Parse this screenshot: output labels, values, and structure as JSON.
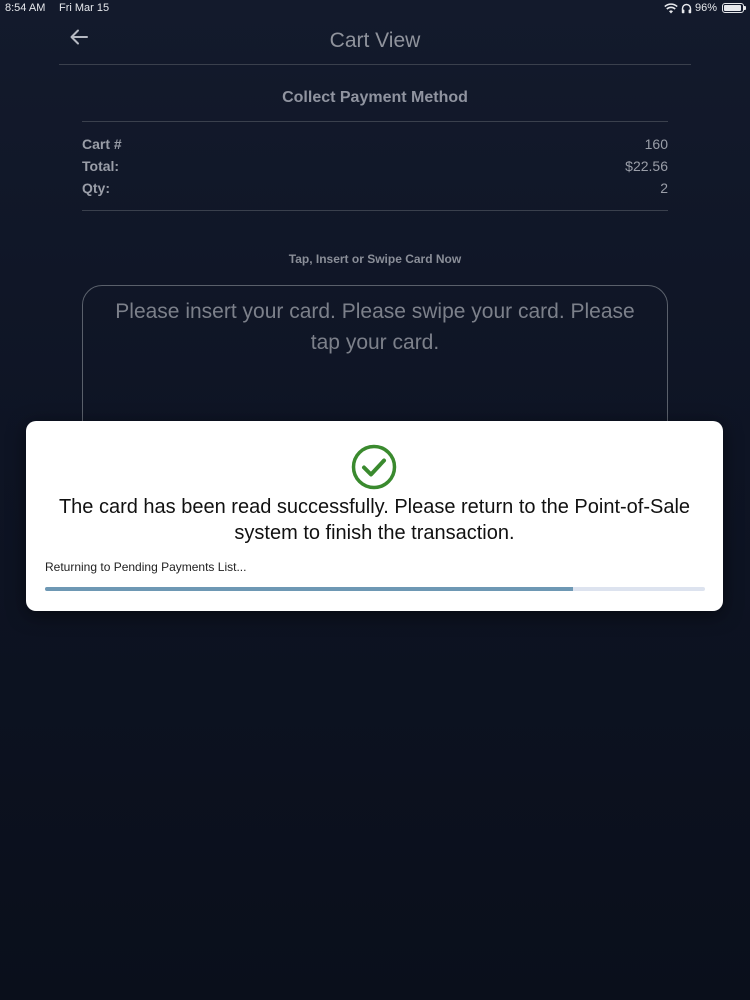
{
  "status_bar": {
    "time": "8:54 AM",
    "date": "Fri Mar 15",
    "battery": "96%",
    "battery_level": 0.96
  },
  "header": {
    "title": "Cart View",
    "back_icon": "arrow-left-icon"
  },
  "section_title": "Collect Payment Method",
  "summary": [
    {
      "label": "Cart #",
      "value": "160"
    },
    {
      "label": "Total:",
      "value": "$22.56"
    },
    {
      "label": "Qty:",
      "value": "2"
    }
  ],
  "instruction": "Tap, Insert or Swipe Card Now",
  "card_prompt": "Please insert your card. Please swipe your card. Please tap your card.",
  "modal": {
    "icon": "check-circle-icon",
    "message": "The card has been read successfully. Please return to the Point-of-Sale system to finish the transaction.",
    "status_text": "Returning to Pending Payments List...",
    "progress": 0.8
  },
  "colors": {
    "success_green": "#3a8a2e",
    "progress_fill": "#6e98b4",
    "background": "#0e1424"
  }
}
